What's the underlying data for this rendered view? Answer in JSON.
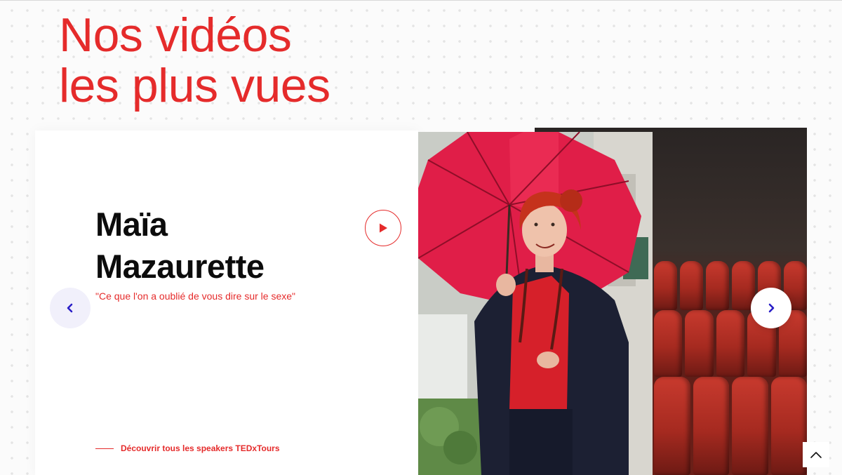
{
  "section": {
    "heading_line1": "Nos vidéos",
    "heading_line2": "les plus vues"
  },
  "featured": {
    "speaker_first_name": "Maïa",
    "speaker_last_name": "Mazaurette",
    "talk_title": "\"Ce que l'on a oublié de vous dire sur le sexe\"",
    "discover_link": "Découvrir tous les speakers TEDxTours"
  },
  "icons": {
    "play": "play-icon",
    "prev": "chevron-left-icon",
    "next": "chevron-right-icon",
    "scroll_top": "chevron-up-icon"
  },
  "colors": {
    "accent": "#e52b2b",
    "nav_arrow": "#2a1fc7",
    "text": "#0c0c0c"
  }
}
